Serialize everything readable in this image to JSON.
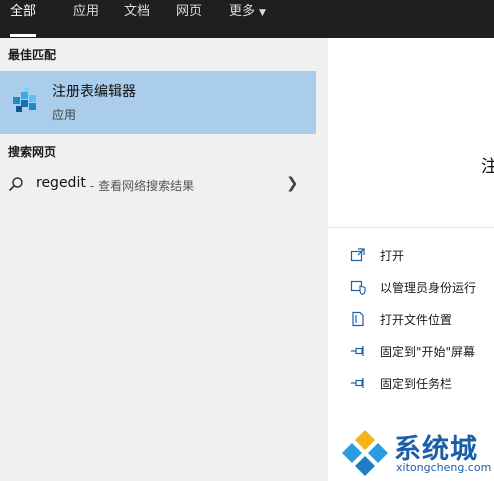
{
  "tabs": [
    {
      "label": "全部",
      "active": true
    },
    {
      "label": "应用"
    },
    {
      "label": "文档"
    },
    {
      "label": "网页"
    },
    {
      "label": "更多",
      "has_dropdown": true
    }
  ],
  "best_match": {
    "section_title": "最佳匹配",
    "app_name": "注册表编辑器",
    "app_type": "应用",
    "icon": "registry-editor-icon"
  },
  "web_search": {
    "section_title": "搜索网页",
    "query": "regedit",
    "hint": "- 查看网络搜索结果"
  },
  "preview": {
    "title_fragment": "注"
  },
  "actions": [
    {
      "label": "打开",
      "icon": "open-icon"
    },
    {
      "label": "以管理员身份运行",
      "icon": "run-as-admin-icon"
    },
    {
      "label": "打开文件位置",
      "icon": "file-location-icon"
    },
    {
      "label": "固定到\"开始\"屏幕",
      "icon": "pin-icon"
    },
    {
      "label": "固定到任务栏",
      "icon": "pin-icon"
    }
  ],
  "watermark": {
    "text": "系统城",
    "url": "xitongcheng.com"
  },
  "colors": {
    "topbar": "#1f1f1f",
    "selected_row": "#a9cdea",
    "accent": "#1b5fa8"
  }
}
